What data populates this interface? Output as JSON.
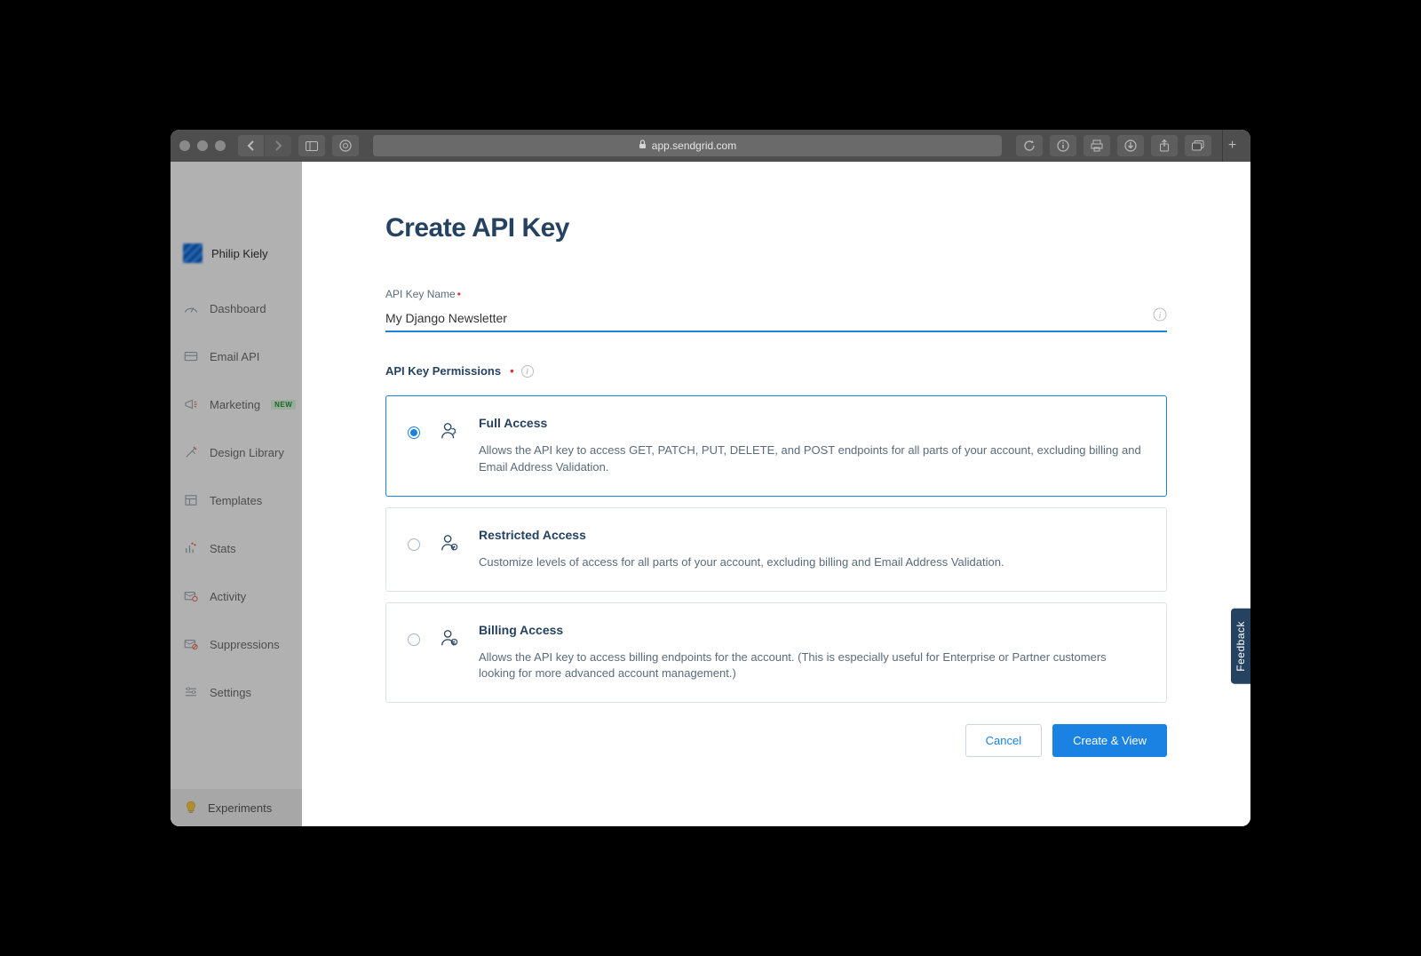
{
  "browser": {
    "address": "app.sendgrid.com"
  },
  "sidebar": {
    "user_name": "Philip Kiely",
    "items": [
      {
        "label": "Dashboard"
      },
      {
        "label": "Email API"
      },
      {
        "label": "Marketing",
        "badge": "NEW"
      },
      {
        "label": "Design Library"
      },
      {
        "label": "Templates"
      },
      {
        "label": "Stats"
      },
      {
        "label": "Activity"
      },
      {
        "label": "Suppressions"
      },
      {
        "label": "Settings"
      }
    ],
    "experiments": "Experiments"
  },
  "page": {
    "title": "Create API Key",
    "api_key_name_label": "API Key Name",
    "api_key_name_value": "My Django Newsletter",
    "permissions_label": "API Key Permissions",
    "permissions": [
      {
        "title": "Full Access",
        "desc": "Allows the API key to access GET, PATCH, PUT, DELETE, and POST endpoints for all parts of your account, excluding billing and Email Address Validation.",
        "selected": true
      },
      {
        "title": "Restricted Access",
        "desc": "Customize levels of access for all parts of your account, excluding billing and Email Address Validation.",
        "selected": false
      },
      {
        "title": "Billing Access",
        "desc": "Allows the API key to access billing endpoints for the account. (This is especially useful for Enterprise or Partner customers looking for more advanced account management.)",
        "selected": false
      }
    ],
    "cancel_label": "Cancel",
    "create_label": "Create & View"
  },
  "feedback_label": "Feedback"
}
